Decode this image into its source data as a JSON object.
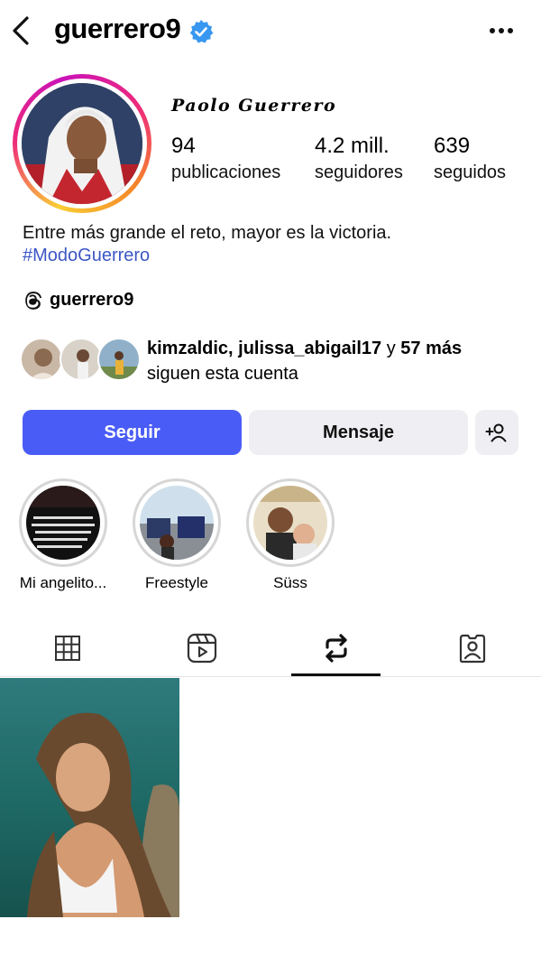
{
  "header": {
    "username": "guerrero9",
    "back_icon": "chevron-left-icon",
    "verified_icon": "verified-badge-icon",
    "more_icon": "more-horizontal-icon"
  },
  "profile": {
    "display_name": "Paolo Guerrero",
    "stats": [
      {
        "value": "94",
        "label": "publicaciones"
      },
      {
        "value": "4.2 mill.",
        "label": "seguidores"
      },
      {
        "value": "639",
        "label": "seguidos"
      }
    ],
    "bio": "Entre más grande el reto, mayor es la victoria.",
    "hashtag": "#ModoGuerrero",
    "threads_handle": "guerrero9"
  },
  "followed_by": {
    "names": "kimzaldic, julissa_abigail17",
    "connector": " y ",
    "more": "57 más",
    "line2": "siguen esta cuenta"
  },
  "actions": {
    "follow_label": "Seguir",
    "message_label": "Mensaje",
    "add_user_icon": "add-user-icon"
  },
  "highlights": [
    {
      "label": "Mi angelito..."
    },
    {
      "label": "Freestyle"
    },
    {
      "label": "Süss"
    }
  ],
  "tabs": [
    {
      "name": "grid",
      "icon": "grid-icon"
    },
    {
      "name": "reels",
      "icon": "reels-icon"
    },
    {
      "name": "reposts",
      "icon": "repost-icon",
      "active": true
    },
    {
      "name": "tagged",
      "icon": "tagged-icon"
    }
  ],
  "colors": {
    "accent": "#4a5cf6",
    "verified": "#3897f0",
    "hashtag": "#3b57c5",
    "secondary_button": "#efeff3"
  }
}
